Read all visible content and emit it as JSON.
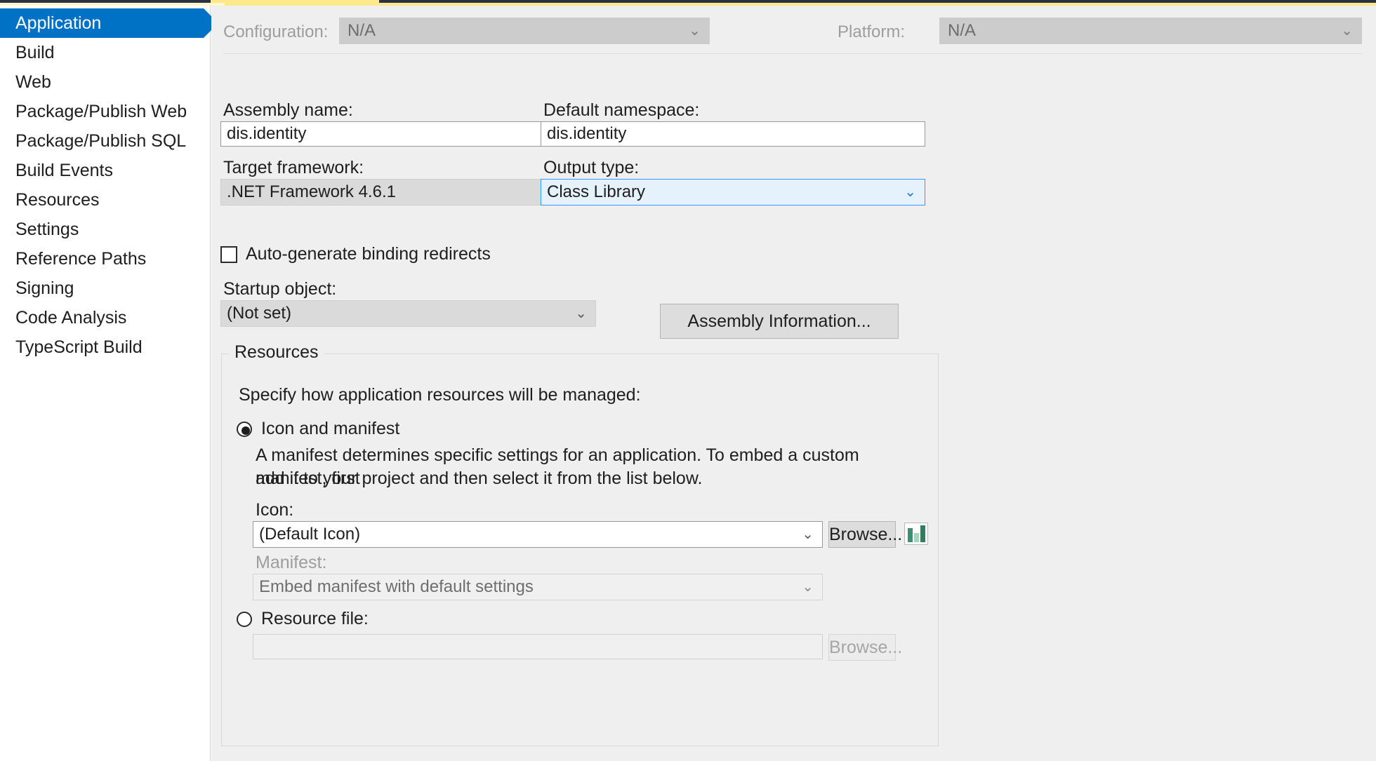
{
  "window": {
    "accent_color": "#0072C6",
    "panel_bg": "#EFEFF0",
    "highlight_color": "#E5F1FB",
    "tab_strip_color": "#FBE98A"
  },
  "sidebar": {
    "items": [
      {
        "label": "Application",
        "selected": true
      },
      {
        "label": "Build",
        "selected": false
      },
      {
        "label": "Web",
        "selected": false
      },
      {
        "label": "Package/Publish Web",
        "selected": false
      },
      {
        "label": "Package/Publish SQL",
        "selected": false
      },
      {
        "label": "Build Events",
        "selected": false
      },
      {
        "label": "Resources",
        "selected": false
      },
      {
        "label": "Settings",
        "selected": false
      },
      {
        "label": "Reference Paths",
        "selected": false
      },
      {
        "label": "Signing",
        "selected": false
      },
      {
        "label": "Code Analysis",
        "selected": false
      },
      {
        "label": "TypeScript Build",
        "selected": false
      }
    ]
  },
  "config_bar": {
    "configuration_label": "Configuration:",
    "configuration_value": "N/A",
    "platform_label": "Platform:",
    "platform_value": "N/A"
  },
  "application": {
    "assembly_name_label": "Assembly name:",
    "assembly_name_value": "dis.identity",
    "default_namespace_label": "Default namespace:",
    "default_namespace_value": "dis.identity",
    "target_framework_label": "Target framework:",
    "target_framework_value": ".NET Framework 4.6.1",
    "output_type_label": "Output type:",
    "output_type_value": "Class Library",
    "auto_generate_binding_redirects_label": "Auto-generate binding redirects",
    "startup_object_label": "Startup object:",
    "startup_object_value": "(Not set)",
    "assembly_information_button": "Assembly Information..."
  },
  "resources": {
    "group_title": "Resources",
    "description": "Specify how application resources will be managed:",
    "icon_and_manifest_label": "Icon and manifest",
    "manifest_paragraph_line1": "A manifest determines specific settings for an application. To embed a custom manifest, first",
    "manifest_paragraph_line2": "add it to your project and then select it from the list below.",
    "icon_label": "Icon:",
    "icon_value": "(Default Icon)",
    "icon_browse_button": "Browse...",
    "manifest_label": "Manifest:",
    "manifest_value": "Embed manifest with default settings",
    "resource_file_label": "Resource file:",
    "resource_file_value": "",
    "resource_browse_button": "Browse..."
  },
  "glyphs": {
    "chevron_down": "⌄"
  }
}
